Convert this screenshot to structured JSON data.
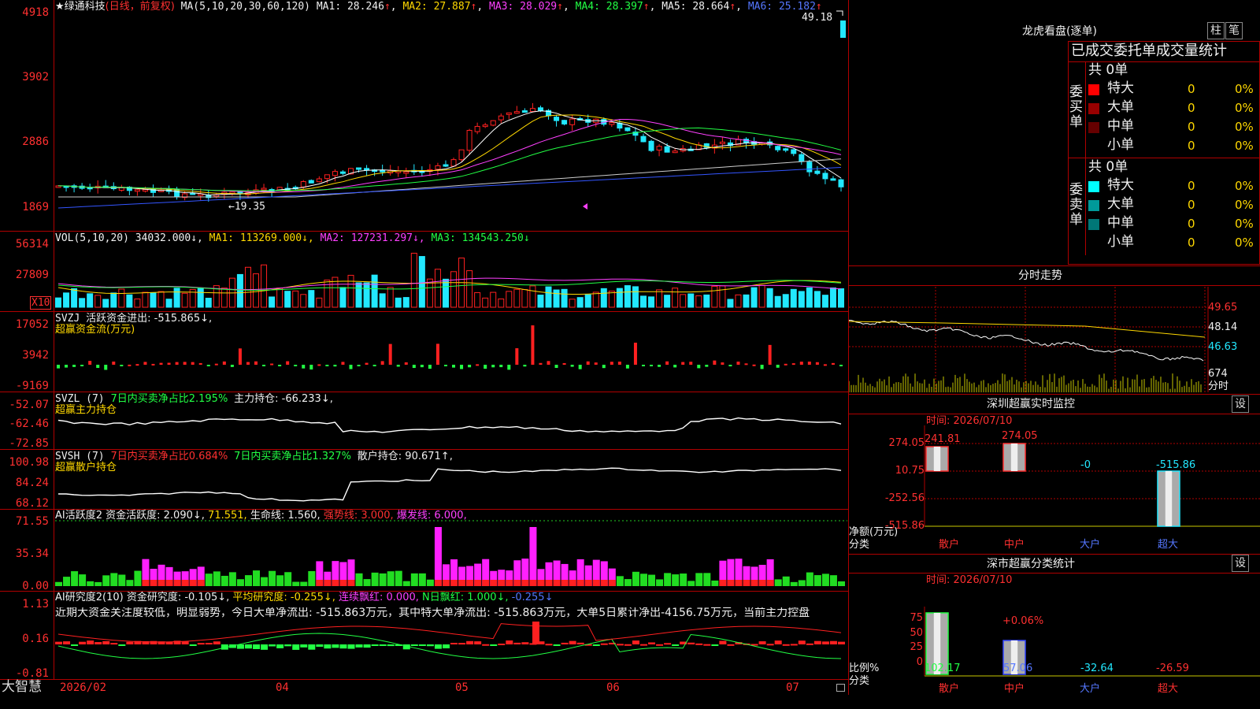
{
  "main": {
    "title": "★绿通科技",
    "period": "(日线，前复权)",
    "ma_label": "MA(5,10,20,30,60,120)",
    "ma": [
      {
        "name": "MA1",
        "value": "28.246",
        "arrow": "↑",
        "color": "#ffffff"
      },
      {
        "name": "MA2",
        "value": "27.887",
        "arrow": "↑",
        "color": "#ffd800"
      },
      {
        "name": "MA3",
        "value": "28.029",
        "arrow": "↑",
        "color": "#ff40ff"
      },
      {
        "name": "MA4",
        "value": "28.397",
        "arrow": "↑",
        "color": "#22ff44"
      },
      {
        "name": "MA5",
        "value": "28.664",
        "arrow": "↑",
        "color": "#cccccc"
      },
      {
        "name": "MA6",
        "value": "25.182",
        "arrow": "↑",
        "color": "#3355ff"
      }
    ],
    "y_ticks": [
      "4918",
      "3902",
      "2886",
      "1869"
    ],
    "high_label": "49.18",
    "low_label": "19.35"
  },
  "vol": {
    "label": "VOL(5,10,20)",
    "value": "34032.000↓,",
    "ma": [
      {
        "name": "MA1",
        "value": "113269.000↓,",
        "color": "#ffd800"
      },
      {
        "name": "MA2",
        "value": "127231.297↓,",
        "color": "#ff40ff"
      },
      {
        "name": "MA3",
        "value": "134543.250↓",
        "color": "#22ff44"
      }
    ],
    "y_ticks": [
      "56314",
      "27809"
    ],
    "unit": "X10"
  },
  "svzj": {
    "label": "SVZJ",
    "text": "活跃资金进出: -515.865↓,",
    "subtitle": "超赢资金流(万元)",
    "y_ticks": [
      "17052",
      "3942",
      "-9169"
    ]
  },
  "svzl": {
    "label": "SVZL (7)",
    "text1": "7日内买卖净占比2.195%",
    "text2": "主力持仓: -66.233↓,",
    "subtitle": "超赢主力持仓",
    "y_ticks": [
      "-52.07",
      "-62.46",
      "-72.85"
    ]
  },
  "svsh": {
    "label": "SVSH (7)",
    "text1": "7日内买卖净占比0.684%",
    "text2": "7日内买卖净占比1.327%",
    "text3": "散户持仓: 90.671↑,",
    "subtitle": "超赢散户持仓",
    "y_ticks": [
      "100.98",
      "84.24",
      "68.12"
    ]
  },
  "ai_active": {
    "label": "AI活跃度2",
    "t1": "资金活跃度: 2.090↓,",
    "t2": "71.551,",
    "t3": "生命线: 1.560,",
    "t4": "强势线: 3.000,",
    "t5": "爆发线: 6.000,",
    "y_ticks": [
      "71.55",
      "35.34",
      "0.00"
    ]
  },
  "ai_research": {
    "label": "AI研究度2(10)",
    "t1": "资金研究度: -0.105↓,",
    "t2": "平均研究度: -0.255↓,",
    "t3": "连续飘红: 0.000,",
    "t4": "N日飘红: 1.000↓,",
    "t5": "-0.255↓",
    "comment": "近期大资金关注度较低，明显弱势，今日大单净流出: -515.863万元，其中特大单净流出: -515.863万元，大单5日累计净出-4156.75万元，当前主力控盘",
    "y_ticks": [
      "1.13",
      "0.16",
      "-0.81"
    ]
  },
  "x_axis": [
    "2026/02",
    "04",
    "05",
    "06",
    "07"
  ],
  "brand": "大智慧",
  "right": {
    "lhb_title": "龙虎看盘(逐单)",
    "btn_zhu": "柱",
    "btn_bi": "笔",
    "stats_title": "已成交委托单成交量统计",
    "buy_label": "委买单",
    "sell_label": "委卖单",
    "buy_total": "共 0单",
    "sell_total": "共 0单",
    "buy_rows": [
      {
        "name": "特大",
        "n": "0",
        "p": "0%",
        "color": "#ff0000"
      },
      {
        "name": "大单",
        "n": "0",
        "p": "0%",
        "color": "#990000"
      },
      {
        "name": "中单",
        "n": "0",
        "p": "0%",
        "color": "#660000"
      },
      {
        "name": "小单",
        "n": "0",
        "p": "0%",
        "color": "#000000"
      }
    ],
    "sell_rows": [
      {
        "name": "特大",
        "n": "0",
        "p": "0%",
        "color": "#00ffff"
      },
      {
        "name": "大单",
        "n": "0",
        "p": "0%",
        "color": "#009999"
      },
      {
        "name": "中单",
        "n": "0",
        "p": "0%",
        "color": "#007777"
      },
      {
        "name": "小单",
        "n": "0",
        "p": "0%",
        "color": "#000000"
      }
    ],
    "fenshi_title": "分时走势",
    "fenshi_y": [
      "49.65",
      "48.14",
      "46.63",
      "674"
    ],
    "fenshi_unit": "分时",
    "monitor_title": "深圳超赢实时监控",
    "monitor_set": "设",
    "monitor_time": "时间: 2026/07/10",
    "monitor_y": [
      "274.05",
      "10.75",
      "-252.56",
      "-515.86"
    ],
    "monitor_vals": [
      "241.81",
      "274.05",
      "-0",
      "-515.86"
    ],
    "monitor_unit1": "净额(万元)",
    "monitor_unit2": "分类",
    "categories": [
      "散户",
      "中户",
      "大户",
      "超大"
    ],
    "class_title": "深市超赢分类统计",
    "class_set": "设",
    "class_time": "时间: 2026/07/10",
    "class_y": [
      "75",
      "50",
      "25",
      "0"
    ],
    "class_pct": "+0.06%",
    "class_vals": [
      "102.17",
      "57.06",
      "-32.64",
      "-26.59"
    ],
    "class_unit1": "比例%",
    "class_unit2": "分类"
  }
}
